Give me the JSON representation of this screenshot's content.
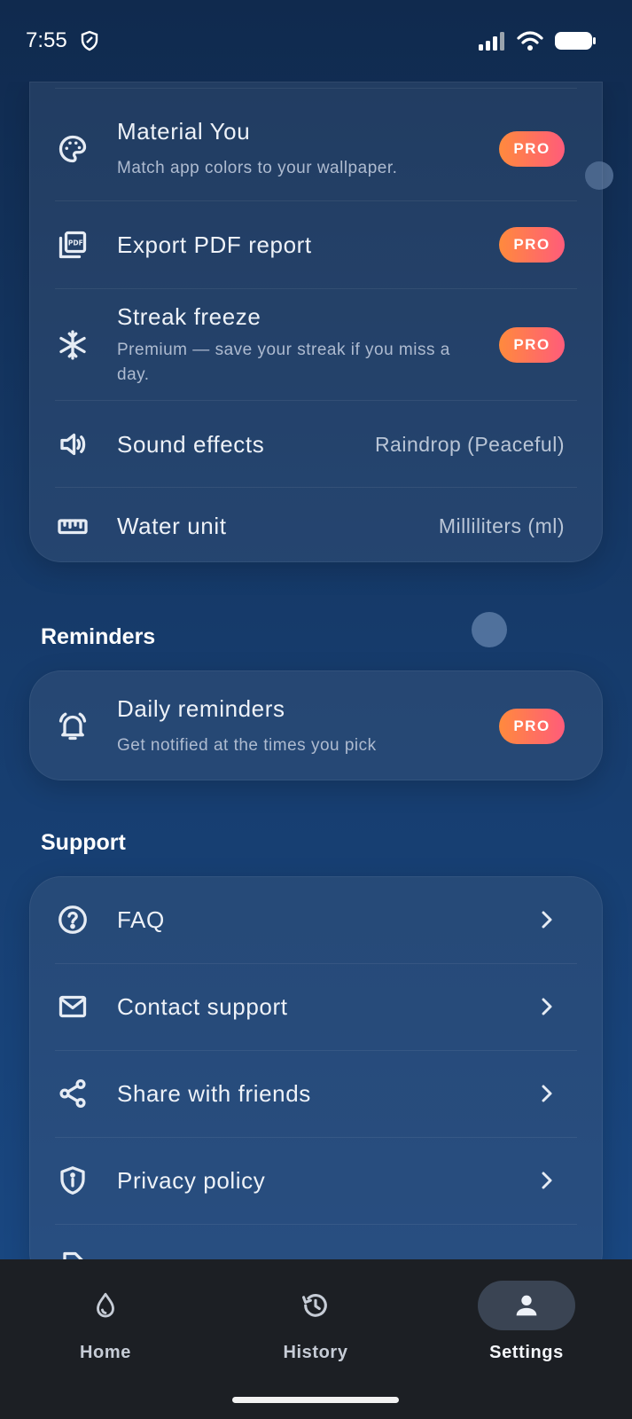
{
  "status": {
    "time": "7:55"
  },
  "general": {
    "items": [
      {
        "title": "Material You",
        "subtitle": "Match app colors to your wallpaper.",
        "badge": "PRO"
      },
      {
        "title": "Export PDF report",
        "badge": "PRO"
      },
      {
        "title": "Streak freeze",
        "subtitle": "Premium — save your streak if you miss a day.",
        "badge": "PRO"
      },
      {
        "title": "Sound effects",
        "value": "Raindrop (Peaceful)"
      },
      {
        "title": "Water unit",
        "value": "Milliliters (ml)"
      }
    ]
  },
  "reminders": {
    "heading": "Reminders",
    "items": [
      {
        "title": "Daily reminders",
        "subtitle": "Get notified at the times you pick",
        "badge": "PRO"
      }
    ]
  },
  "support": {
    "heading": "Support",
    "items": [
      {
        "title": "FAQ"
      },
      {
        "title": "Contact support"
      },
      {
        "title": "Share with friends"
      },
      {
        "title": "Privacy policy"
      }
    ]
  },
  "nav": {
    "items": [
      {
        "label": "Home",
        "icon": "droplet-icon"
      },
      {
        "label": "History",
        "icon": "history-icon"
      },
      {
        "label": "Settings",
        "icon": "person-icon",
        "active": true
      }
    ]
  },
  "colors": {
    "pro_start": "#ff8a3d",
    "pro_end": "#ff5c7a",
    "nav_bg": "#1c1f24"
  }
}
